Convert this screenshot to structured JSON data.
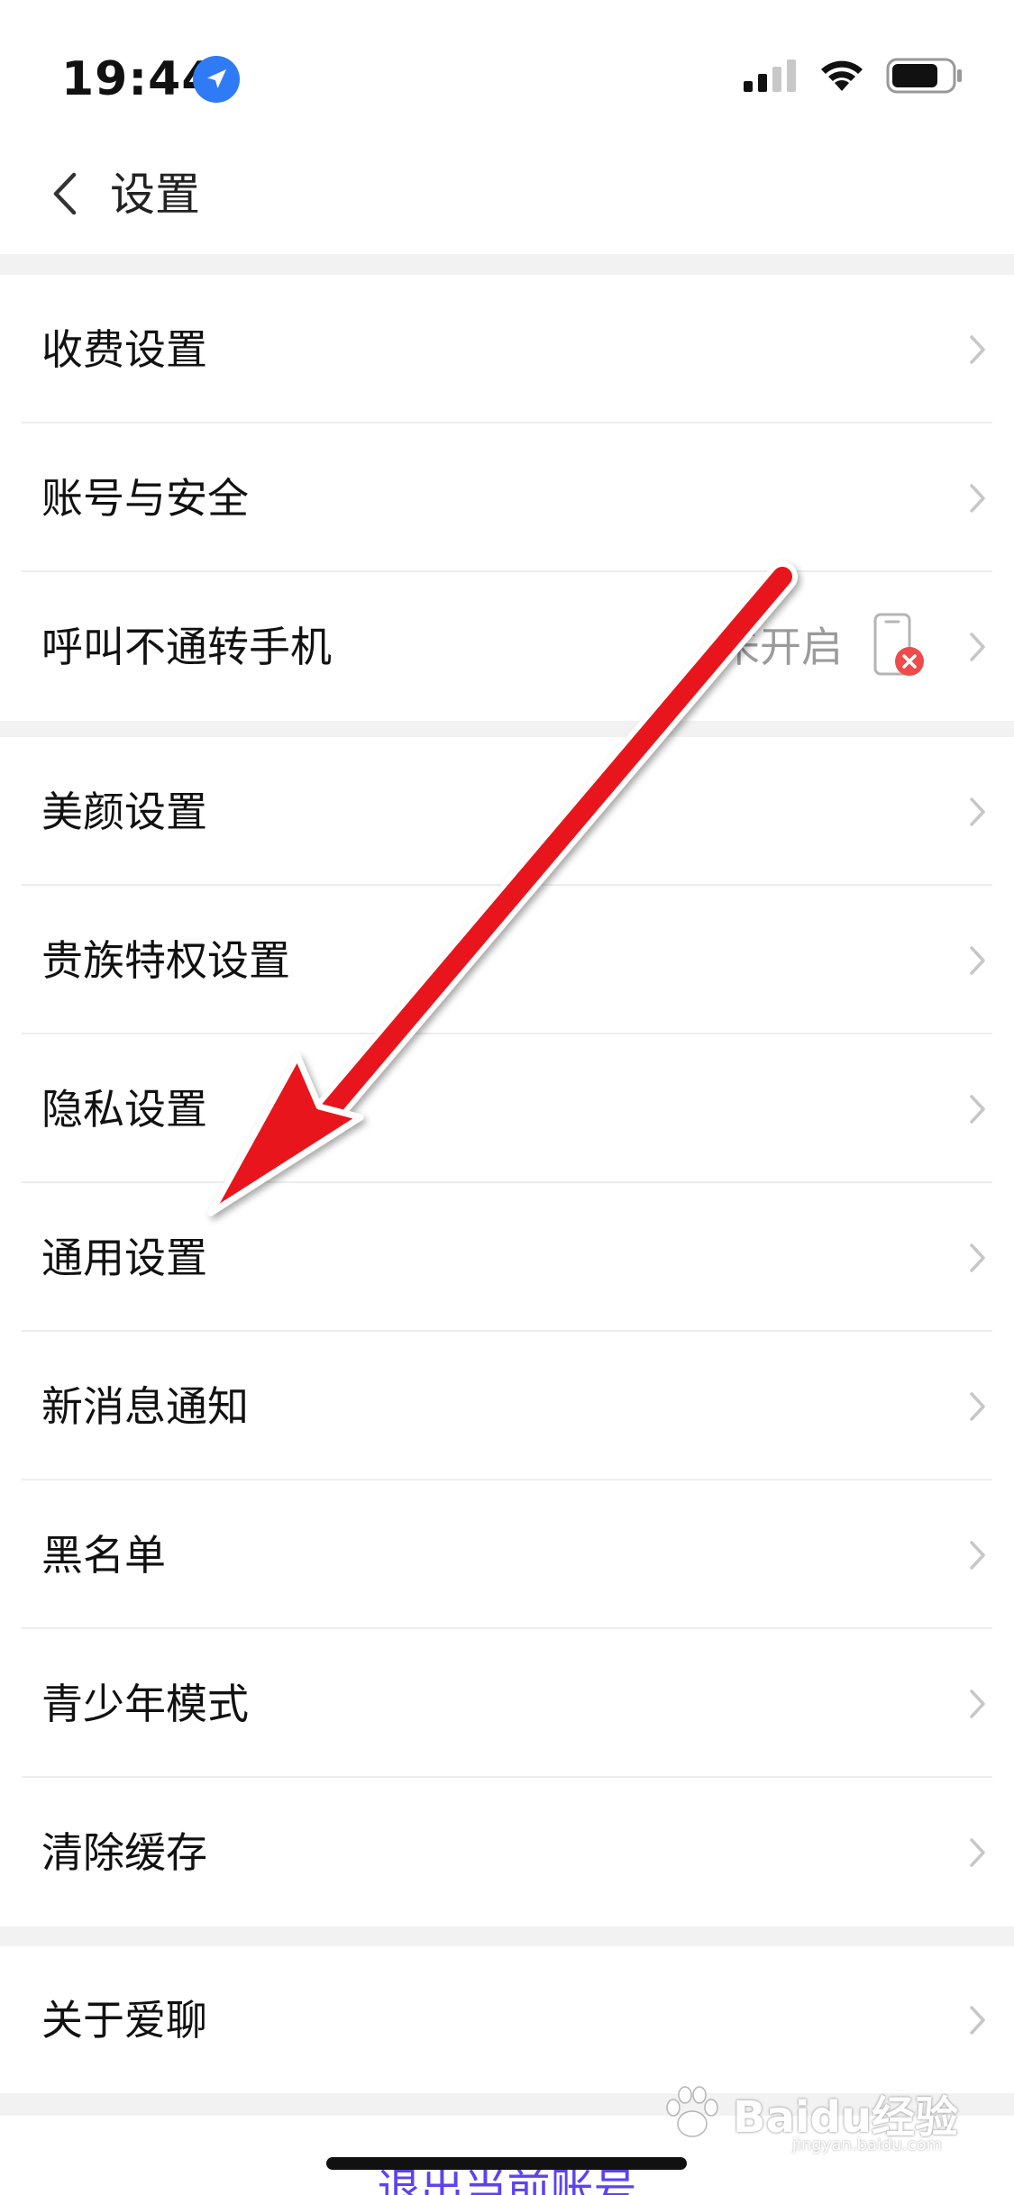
{
  "status_bar": {
    "time": "19:44",
    "icons": [
      "location-arrow-icon",
      "cellular-signal-icon",
      "wifi-icon",
      "battery-icon"
    ]
  },
  "nav": {
    "title": "设置",
    "back_icon": "chevron-left-icon"
  },
  "groups": [
    {
      "items": [
        {
          "label": "收费设置"
        },
        {
          "label": "账号与安全"
        },
        {
          "label": "呼叫不通转手机",
          "status": "未开启",
          "status_icon": "phone-off-icon"
        }
      ]
    },
    {
      "items": [
        {
          "label": "美颜设置"
        },
        {
          "label": "贵族特权设置"
        },
        {
          "label": "隐私设置"
        },
        {
          "label": "通用设置"
        },
        {
          "label": "新消息通知"
        },
        {
          "label": "黑名单"
        },
        {
          "label": "青少年模式"
        },
        {
          "label": "清除缓存"
        }
      ]
    },
    {
      "items": [
        {
          "label": "关于爱聊"
        }
      ]
    }
  ],
  "logout": {
    "label": "退出当前账号"
  },
  "annotation": {
    "type": "red-arrow",
    "points_to": "通用设置"
  },
  "watermark": {
    "text": "Baidu经验",
    "sub": "jingyan.baidu.com"
  },
  "colors": {
    "background": "#f2f2f2",
    "row_background": "#ffffff",
    "accent": "#5b43f0",
    "arrow": "#e8121c",
    "status_text": "#9b9b9b",
    "location_blue": "#2f7bf5"
  }
}
